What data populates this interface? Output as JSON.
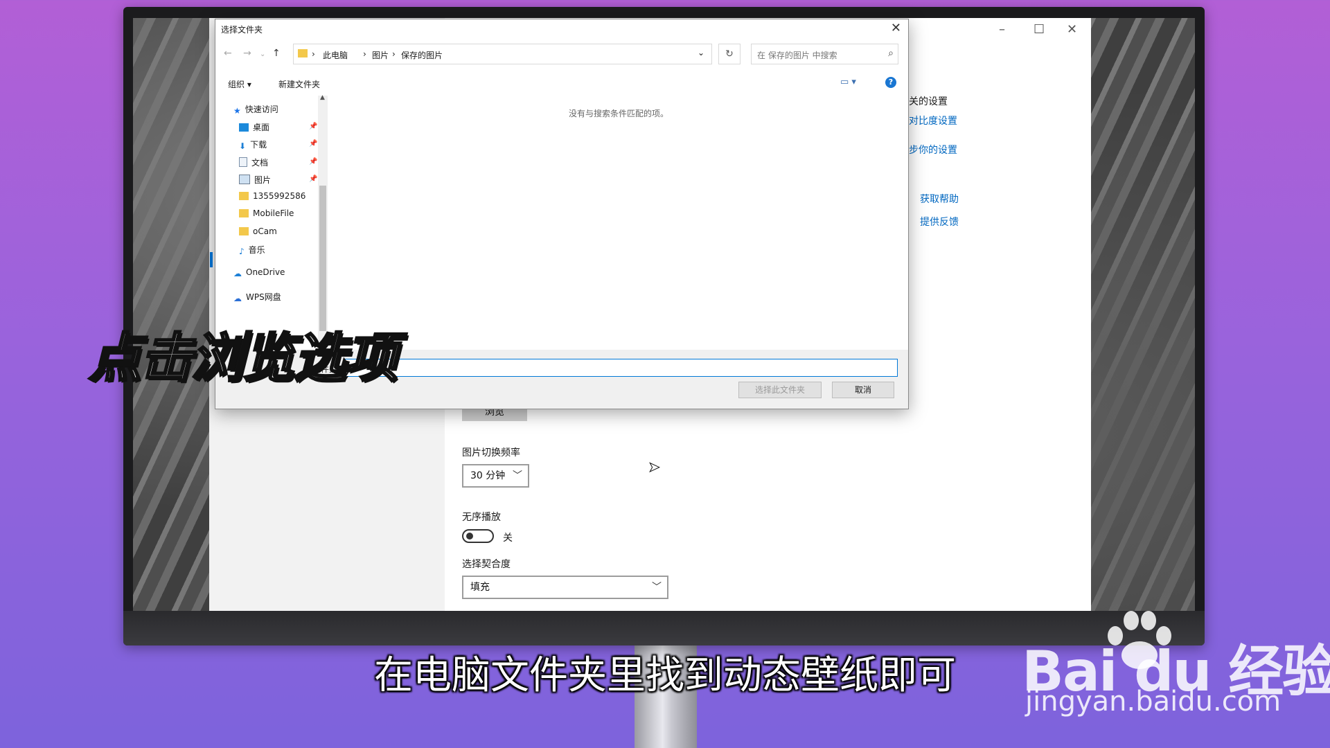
{
  "overlay": {
    "title": "点击浏览选项",
    "subtitle": "在电脑文件夹里找到动态壁纸即可",
    "watermark_brand": "Bai  du 经验",
    "watermark_url": "jingyan.baidu.com"
  },
  "settings": {
    "related_heading": "关的设置",
    "links": [
      "对比度设置",
      "步你的设置",
      "获取帮助",
      "提供反馈"
    ],
    "browse_label": "浏览",
    "interval_label": "图片切换频率",
    "interval_value": "30 分钟",
    "shuffle_label": "无序播放",
    "shuffle_state": "关",
    "fit_label": "选择契合度",
    "fit_value": "填充"
  },
  "dialog": {
    "title": "选择文件夹",
    "breadcrumb": [
      "此电脑",
      "图片",
      "保存的图片"
    ],
    "search_placeholder": "在 保存的图片 中搜索",
    "toolbar": {
      "organize": "组织 ▾",
      "new_folder": "新建文件夹"
    },
    "tree": [
      {
        "label": "快速访问",
        "icon": "star-icon",
        "pinned": false
      },
      {
        "label": "桌面",
        "icon": "desktop-icon",
        "pinned": true
      },
      {
        "label": "下载",
        "icon": "download-icon",
        "pinned": true
      },
      {
        "label": "文档",
        "icon": "document-icon",
        "pinned": true
      },
      {
        "label": "图片",
        "icon": "pictures-icon",
        "pinned": true
      },
      {
        "label": "1355992586",
        "icon": "folder-icon",
        "pinned": false
      },
      {
        "label": "MobileFile",
        "icon": "folder-icon",
        "pinned": false
      },
      {
        "label": "oCam",
        "icon": "folder-icon",
        "pinned": false
      },
      {
        "label": "音乐",
        "icon": "music-icon",
        "pinned": false
      },
      {
        "label": "OneDrive",
        "icon": "cloud-icon",
        "pinned": false
      },
      {
        "label": "WPS网盘",
        "icon": "cloud-icon",
        "pinned": false
      }
    ],
    "empty_message": "没有与搜索条件匹配的项。",
    "folder_label": "文件夹:",
    "select_button": "选择此文件夹",
    "cancel_button": "取消"
  }
}
